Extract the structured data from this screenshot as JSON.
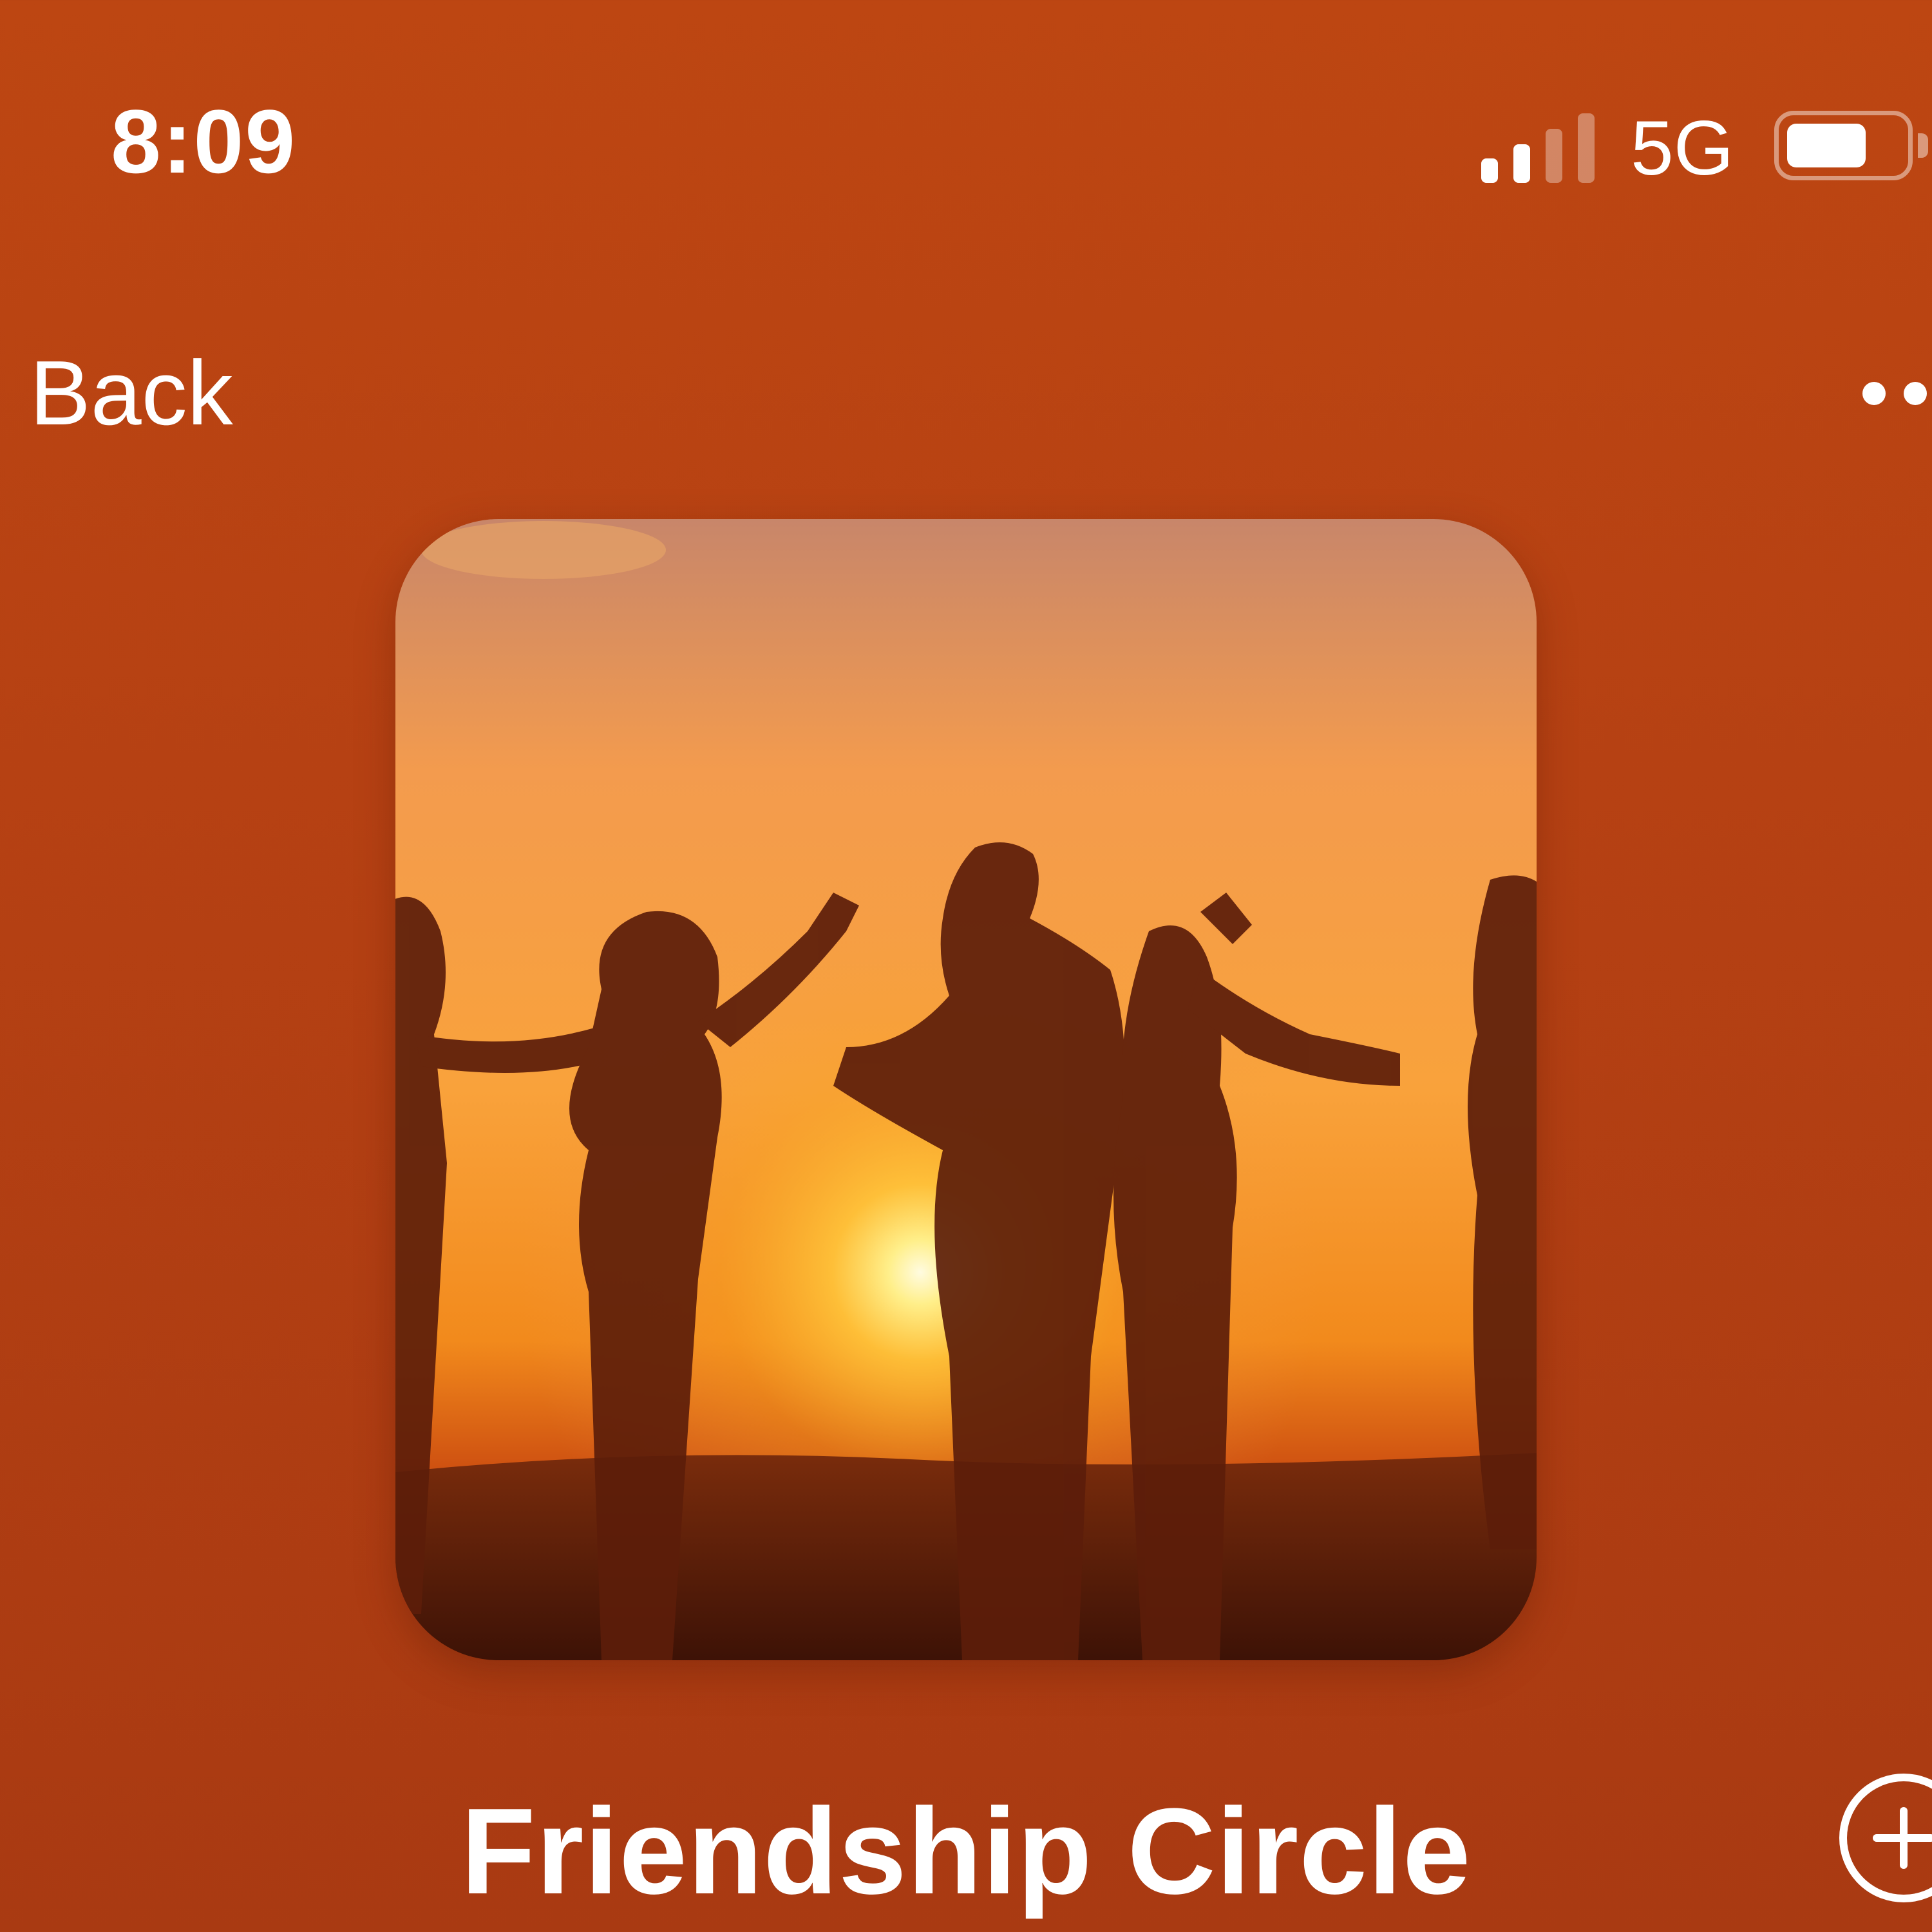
{
  "status_bar": {
    "time": "8:09",
    "network": "5G",
    "signal_bars_active": 2,
    "signal_bars_total": 4,
    "battery_level": 0.7,
    "icons": [
      "signal-icon",
      "battery-icon"
    ]
  },
  "nav": {
    "back_label": "Back",
    "more_icon": "more-icon"
  },
  "playlist": {
    "title": "Friendship Circle",
    "artwork_icon": "artwork-image",
    "add_icon": "add-circle-icon"
  },
  "colors": {
    "background": "#b64113",
    "text": "#ffffff"
  }
}
